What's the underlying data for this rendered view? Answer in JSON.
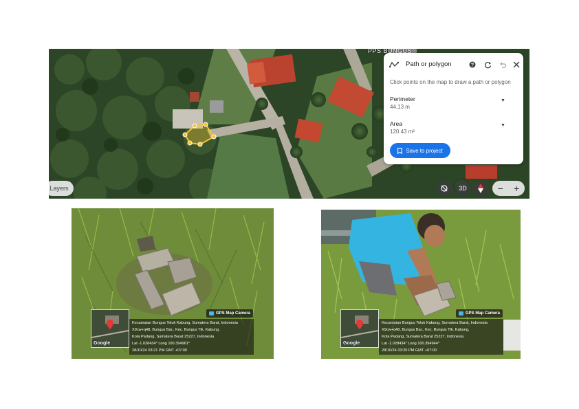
{
  "map": {
    "place_label": "PPS BUNGUS",
    "layers_label": "Layers",
    "controls": {
      "rotate_icon": "rotate-icon",
      "tilt_label": "3D",
      "compass_icon": "compass-icon",
      "zoom_out_label": "−",
      "zoom_in_label": "+"
    },
    "panel": {
      "title": "Path or polygon",
      "hint": "Click points on the map to draw a path or polygon",
      "perimeter_label": "Perimeter",
      "perimeter_value": "44.13 m",
      "area_label": "Area",
      "area_value": "120.43 m²",
      "save_label": "Save to project",
      "caret": "▼"
    }
  },
  "photos": [
    {
      "badge": "GPS Map Camera",
      "google": "Google",
      "lines": [
        "Kecamatan Bungus Teluk Kabung, Sumatera Barat, Indonesia",
        "X9cw+q48, Bungus Bar., Kec. Bungus Tlk. Kabung,",
        "Kota Padang, Sumatera Barat 25227, Indonesia",
        "Lat -1.028434° Long 100.394961°",
        "28/10/24 03:21 PM GMT +07:00"
      ]
    },
    {
      "badge": "GPS Map Camera",
      "google": "Google",
      "lines": [
        "Kecamatan Bungus Teluk Kabung, Sumatera Barat, Indonesia",
        "X9cw+q48, Bungus Bar., Kec. Bungus Tlk. Kabung,",
        "Kota Padang, Sumatera Barat 25227, Indonesia",
        "Lat -1.028434° Long 100.394944°",
        "28/10/24 03:20 PM GMT +07:00"
      ]
    }
  ],
  "colors": {
    "accent": "#1a73e8",
    "polygon": "#f9c22e"
  }
}
